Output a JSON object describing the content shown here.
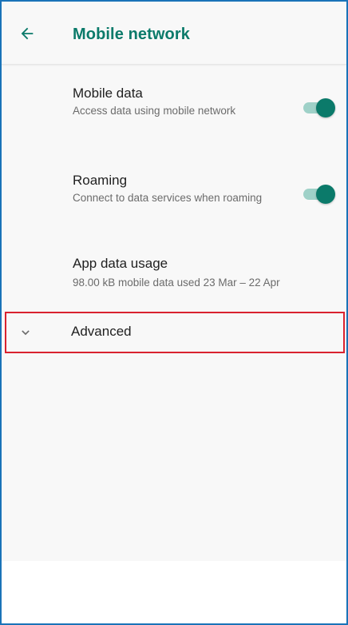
{
  "appbar": {
    "title": "Mobile network",
    "back_icon": "arrow-left-icon"
  },
  "preferences": [
    {
      "title": "Mobile data",
      "summary": "Access data using mobile network",
      "toggle_on": true
    },
    {
      "title": "Roaming",
      "summary": "Connect to data services when roaming",
      "toggle_on": true
    },
    {
      "title": "App data usage",
      "summary": "98.00 kB mobile data used 23 Mar – 22 Apr"
    }
  ],
  "advanced": {
    "label": "Advanced",
    "icon": "chevron-down-icon"
  },
  "colors": {
    "accent": "#0b7a6a",
    "toggle_track": "#9fd1c8",
    "highlight_border": "#d9222f",
    "frame_border": "#1a73b8",
    "background": "#f8f8f8"
  }
}
